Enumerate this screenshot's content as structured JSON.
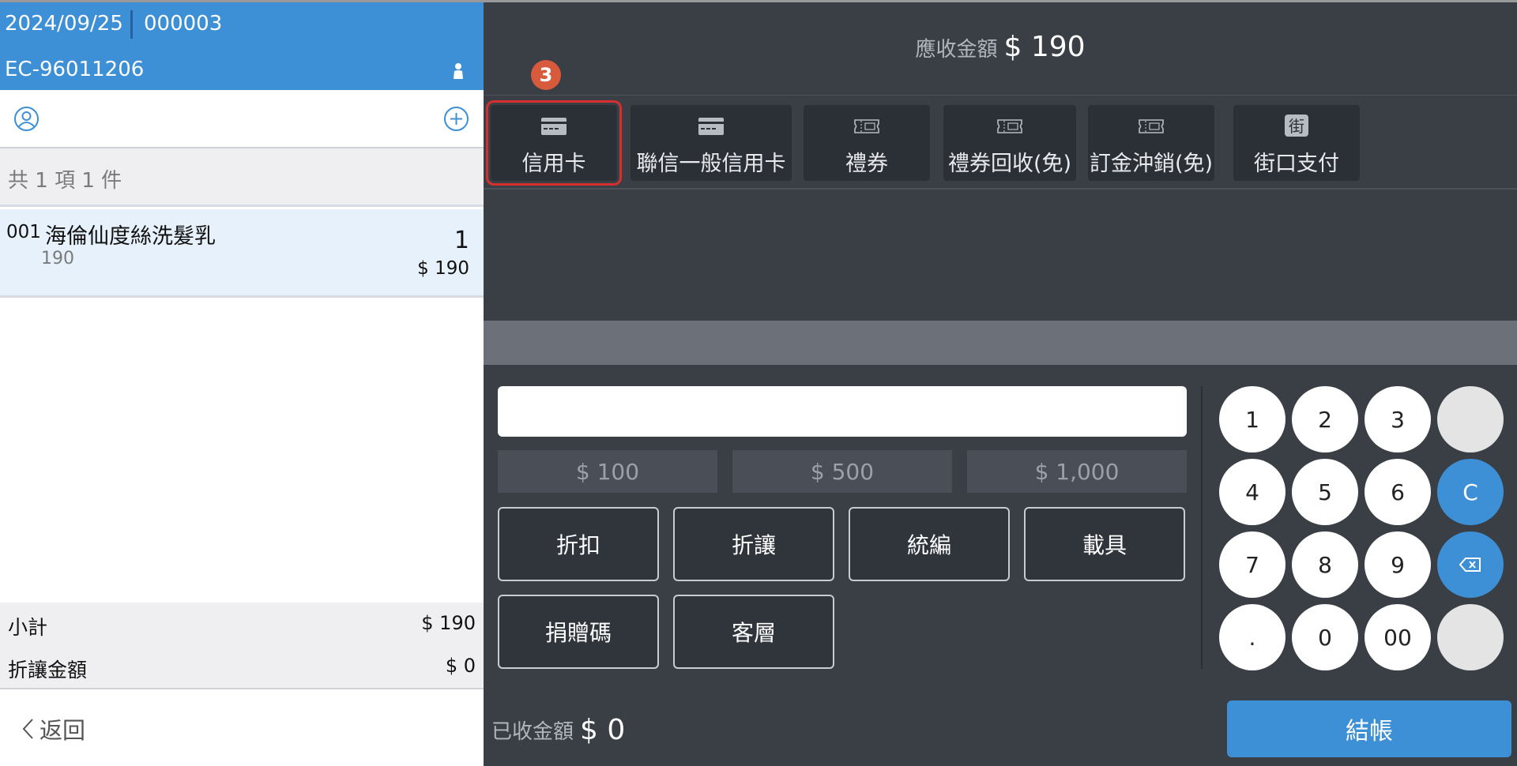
{
  "header": {
    "date": "2024/09/25",
    "order_no": "000003",
    "store_id": "EC-96011206"
  },
  "cart": {
    "summary": "共 1 項 1 件",
    "items": [
      {
        "code": "001",
        "name": "海倫仙度絲洗髮乳",
        "unit_price": "190",
        "qty": "1",
        "total": "$ 190"
      }
    ]
  },
  "totals": {
    "subtotal_label": "小計",
    "subtotal_value": "$ 190",
    "discount_label": "折讓金額",
    "discount_value": "$ 0"
  },
  "back_label": "返回",
  "payment": {
    "due_label": "應收金額",
    "due_amount": "$ 190",
    "step_badge": "3",
    "methods": [
      {
        "label": "信用卡",
        "icon": "credit-card-icon"
      },
      {
        "label": "聯信一般信用卡",
        "icon": "credit-card-icon"
      },
      {
        "label": "禮券",
        "icon": "voucher-icon"
      },
      {
        "label": "禮券回收(免)",
        "icon": "voucher-icon"
      },
      {
        "label": "訂金沖銷(免)",
        "icon": "voucher-icon"
      },
      {
        "label": "街口支付",
        "icon": "jko-pay-icon",
        "icon_text": "街"
      }
    ],
    "input_value": "",
    "quick_amounts": [
      "$ 100",
      "$ 500",
      "$ 1,000"
    ],
    "functions": [
      "折扣",
      "折讓",
      "統編",
      "載具",
      "捐贈碼",
      "客層"
    ],
    "keypad": [
      "1",
      "2",
      "3",
      "",
      "4",
      "5",
      "6",
      "C",
      "7",
      "8",
      "9",
      "",
      ".",
      "0",
      "00",
      ""
    ],
    "received_label": "已收金額",
    "received_amount": "$ 0",
    "checkout_label": "結帳"
  },
  "colors": {
    "header_blue": "#3d8fd6",
    "panel_dark": "#3a3f46",
    "button_dark": "#2b3037",
    "highlight_red": "#d62f2f",
    "badge_orange": "#d85a3c"
  }
}
